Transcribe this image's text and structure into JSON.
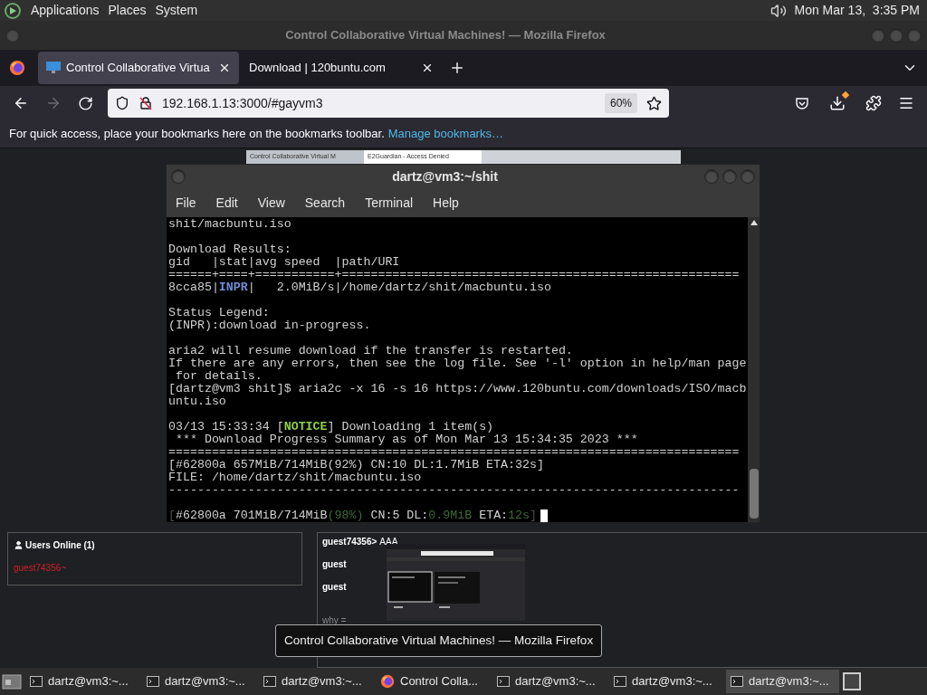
{
  "top_panel": {
    "menus": [
      "Applications",
      "Places",
      "System"
    ],
    "clock": "Mon Mar 13,  3:35 PM"
  },
  "window": {
    "title": "Control Collaborative Virtual Machines! — Mozilla Firefox"
  },
  "tabs": [
    {
      "label": "Control Collaborative Virtua",
      "selected": true
    },
    {
      "label": "Download | 120buntu.com",
      "selected": false
    }
  ],
  "nav": {
    "url": "192.168.1.13:3000/#gayvm3",
    "zoom": "60%"
  },
  "bookmarks_bar": {
    "message": "For quick access, place your bookmarks here on the bookmarks toolbar.",
    "link": "Manage bookmarks…"
  },
  "remote_screen": {
    "tabs": [
      {
        "label": "Control Collaborative Virtual M",
        "selected": false
      },
      {
        "label": "E2Guardian - Access Denied",
        "selected": true
      }
    ],
    "terminal": {
      "title": "dartz@vm3:~/shit",
      "menus": [
        "File",
        "Edit",
        "View",
        "Search",
        "Terminal",
        "Help"
      ],
      "lines": [
        {
          "kind": "text",
          "segments": [
            {
              "text": "shit/macbuntu.iso",
              "kind": "plain"
            }
          ]
        },
        {
          "kind": "blank"
        },
        {
          "kind": "text",
          "segments": [
            {
              "text": "Download Results:",
              "kind": "plain"
            }
          ]
        },
        {
          "kind": "text",
          "segments": [
            {
              "text": "gid   |stat|avg speed  |path/URI",
              "kind": "plain"
            }
          ]
        },
        {
          "kind": "text",
          "segments": [
            {
              "text": "======+====+===========+=======================================================",
              "kind": "plain"
            }
          ]
        },
        {
          "kind": "text",
          "segments": [
            {
              "text": "8cca85|",
              "kind": "plain"
            },
            {
              "text": "INPR",
              "kind": "bold_blue"
            },
            {
              "text": "|   2.0MiB/s|/home/dartz/shit/macbuntu.iso",
              "kind": "plain"
            }
          ]
        },
        {
          "kind": "blank"
        },
        {
          "kind": "text",
          "segments": [
            {
              "text": "Status Legend:",
              "kind": "plain"
            }
          ]
        },
        {
          "kind": "text",
          "segments": [
            {
              "text": "(INPR):download in-progress.",
              "kind": "plain"
            }
          ]
        },
        {
          "kind": "blank"
        },
        {
          "kind": "text",
          "segments": [
            {
              "text": "aria2 will resume download if the transfer is restarted.",
              "kind": "plain"
            }
          ]
        },
        {
          "kind": "text",
          "segments": [
            {
              "text": "If there are any errors, then see the log file. See '-l' option in help/man page",
              "kind": "plain"
            }
          ]
        },
        {
          "kind": "text",
          "segments": [
            {
              "text": " for details.",
              "kind": "plain"
            }
          ]
        },
        {
          "kind": "text",
          "segments": [
            {
              "text": "[dartz@vm3 shit]$ aria2c -x 16 -s 16 https://www.120buntu.com/downloads/ISO/macb",
              "kind": "plain"
            }
          ]
        },
        {
          "kind": "text",
          "segments": [
            {
              "text": "untu.iso",
              "kind": "plain"
            }
          ]
        },
        {
          "kind": "blank"
        },
        {
          "kind": "text",
          "segments": [
            {
              "text": "03/13 15:33:34 [",
              "kind": "plain"
            },
            {
              "text": "NOTICE",
              "kind": "bold_green"
            },
            {
              "text": "] Downloading 1 item(s)",
              "kind": "plain"
            }
          ]
        },
        {
          "kind": "text",
          "segments": [
            {
              "text": " *** Download Progress Summary as of Mon Mar 13 15:34:35 2023 ***",
              "kind": "plain"
            }
          ]
        },
        {
          "kind": "text",
          "segments": [
            {
              "text": "===============================================================================",
              "kind": "plain"
            }
          ]
        },
        {
          "kind": "text",
          "segments": [
            {
              "text": "[#62800a 657MiB/714MiB(92%) CN:10 DL:1.7MiB ETA:32s]",
              "kind": "plain"
            }
          ]
        },
        {
          "kind": "text",
          "segments": [
            {
              "text": "FILE: /home/dartz/shit/macbuntu.iso",
              "kind": "plain"
            }
          ]
        },
        {
          "kind": "text",
          "segments": [
            {
              "text": "-------------------------------------------------------------------------------",
              "kind": "plain"
            }
          ]
        },
        {
          "kind": "blank"
        },
        {
          "kind": "text",
          "cursor": true,
          "segments": [
            {
              "text": "[",
              "kind": "dim_gray"
            },
            {
              "text": "#62800a 701MiB/714MiB",
              "kind": "plain"
            },
            {
              "text": "(98%)",
              "kind": "dim_green"
            },
            {
              "text": " CN:5 DL:",
              "kind": "plain"
            },
            {
              "text": "0.9MiB",
              "kind": "dim_green"
            },
            {
              "text": " ETA:",
              "kind": "plain"
            },
            {
              "text": "12s",
              "kind": "dim_green"
            },
            {
              "text": "]",
              "kind": "dim_gray"
            }
          ]
        }
      ]
    }
  },
  "users_panel": {
    "title": "Users Online (1)",
    "users": [
      {
        "name": "guest74356~",
        "color": "#c8202a"
      }
    ]
  },
  "chat": {
    "messages": [
      {
        "user": "guest74356>",
        "text": "AAA"
      },
      {
        "user": "guest"
      },
      {
        "user": "guest"
      },
      {
        "text": "why ="
      }
    ]
  },
  "tooltip": "Control Collaborative Virtual Machines! — Mozilla Firefox",
  "taskbar": {
    "items": [
      {
        "kind": "terminal",
        "label": "dartz@vm3:~...",
        "selected": false
      },
      {
        "kind": "terminal",
        "label": "dartz@vm3:~...",
        "selected": false
      },
      {
        "kind": "terminal",
        "label": "dartz@vm3:~...",
        "selected": false
      },
      {
        "kind": "browser",
        "label": "Control Colla...",
        "selected": false
      },
      {
        "kind": "terminal",
        "label": "dartz@vm3:~...",
        "selected": false
      },
      {
        "kind": "terminal",
        "label": "dartz@vm3:~...",
        "selected": false
      },
      {
        "kind": "terminal",
        "label": "dartz@vm3:~...",
        "selected": true
      }
    ]
  }
}
